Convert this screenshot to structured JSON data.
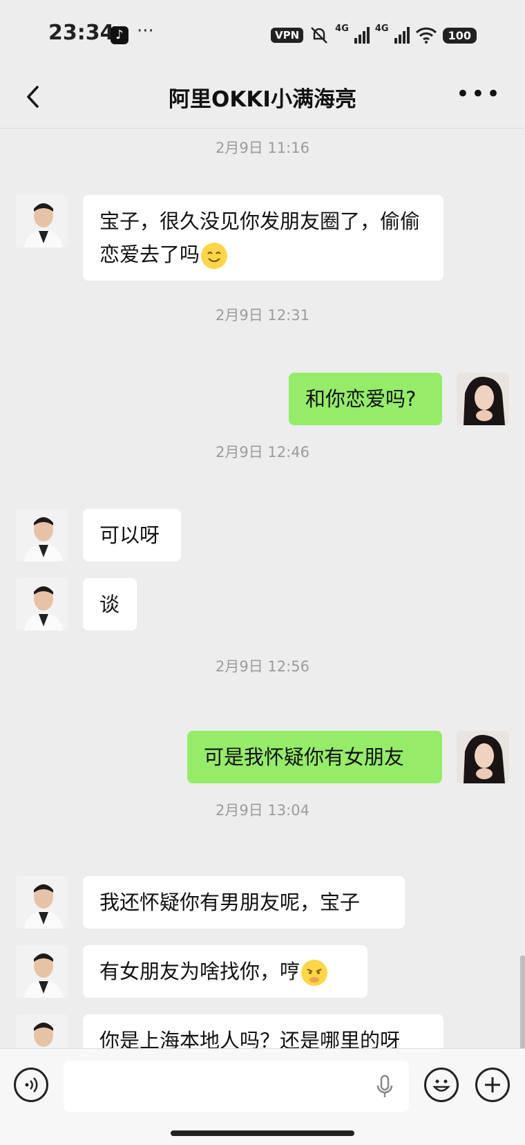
{
  "status_bar": {
    "time": "23:34",
    "more": "···",
    "vpn": "VPN",
    "net1": "4G",
    "net2": "4G",
    "battery": "100"
  },
  "header": {
    "title": "阿里OKKI小满海亮",
    "more": "•••"
  },
  "messages": {
    "ts1": "2月9日 11:16",
    "m1": "宝子，很久没见你发朋友圈了，偷偷恋爱去了吗",
    "ts2": "2月9日 12:31",
    "m2": "和你恋爱吗?",
    "ts3": "2月9日 12:46",
    "m3": "可以呀",
    "m4": "谈",
    "ts4": "2月9日 12:56",
    "m5": "可是我怀疑你有女朋友",
    "ts5": "2月9日 13:04",
    "m6": "我还怀疑你有男朋友呢，宝子",
    "m7": "有女朋友为啥找你，哼",
    "m8": "你是上海本地人吗？还是哪里的呀"
  },
  "icons": {
    "back": "chevron-left-icon",
    "more": "more-icon",
    "voice": "voice-icon",
    "mic": "mic-icon",
    "emoji": "emoji-icon",
    "plus": "plus-icon"
  },
  "colors": {
    "background": "#ededed",
    "outgoing_bubble": "#95ec69",
    "incoming_bubble": "#ffffff",
    "timestamp": "#9b9b9b"
  }
}
